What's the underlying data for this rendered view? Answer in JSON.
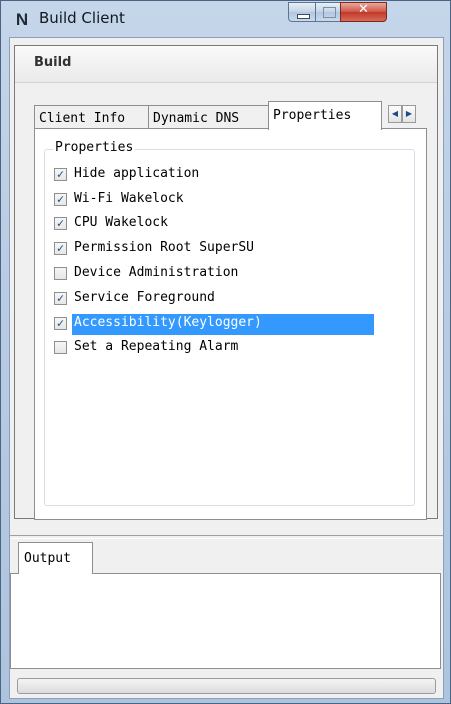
{
  "window": {
    "title": "Build Client",
    "app_icon": "N",
    "close_glyph": "✕"
  },
  "build": {
    "header": "Build",
    "tabs": [
      {
        "label": "Client Info",
        "active": false
      },
      {
        "label": "Dynamic DNS",
        "active": false
      },
      {
        "label": "Properties",
        "active": true
      }
    ],
    "tab_scroll": {
      "left": "◀",
      "right": "▶"
    },
    "properties": {
      "legend": "Properties",
      "options": [
        {
          "label": "Hide application",
          "checked": true,
          "selected": false
        },
        {
          "label": "Wi-Fi Wakelock",
          "checked": true,
          "selected": false
        },
        {
          "label": "CPU Wakelock",
          "checked": true,
          "selected": false
        },
        {
          "label": "Permission Root SuperSU",
          "checked": true,
          "selected": false
        },
        {
          "label": "Device Administration",
          "checked": false,
          "selected": false
        },
        {
          "label": "Service Foreground",
          "checked": true,
          "selected": false
        },
        {
          "label": "Accessibility(Keylogger)",
          "checked": true,
          "selected": true
        },
        {
          "label": "Set a Repeating Alarm",
          "checked": false,
          "selected": false
        }
      ]
    }
  },
  "output": {
    "tab_label": "Output",
    "text": ""
  },
  "progress": {
    "value": 0
  },
  "colors": {
    "selection": "#3399ff",
    "titlebar": "#b9cce3",
    "close_button": "#c0392b"
  },
  "icons": {
    "check": "✓"
  }
}
